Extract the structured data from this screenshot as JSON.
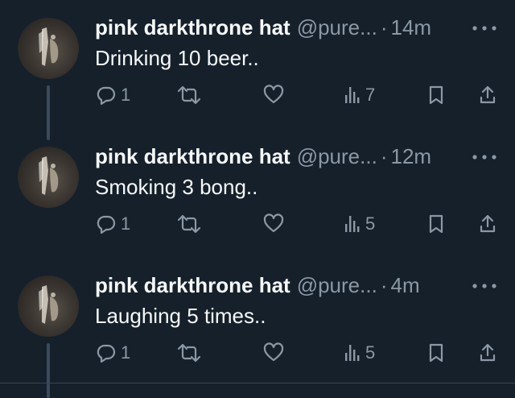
{
  "colors": {
    "background": "#15202b",
    "text_primary": "#f7f9f9",
    "text_secondary": "#8b98a5",
    "thread_line": "#3a4a5a"
  },
  "tweets": [
    {
      "name": "pink darkthrone hat",
      "handle": "@pure...",
      "separator": "·",
      "time": "14m",
      "text": "Drinking 10 beer..",
      "replies": "1",
      "views": "7",
      "icons": [
        "more-icon",
        "reply-icon",
        "retweet-icon",
        "like-icon",
        "views-icon",
        "bookmark-icon",
        "share-icon"
      ]
    },
    {
      "name": "pink darkthrone hat",
      "handle": "@pure...",
      "separator": "·",
      "time": "12m",
      "text": "Smoking 3 bong..",
      "replies": "1",
      "views": "5",
      "icons": [
        "more-icon",
        "reply-icon",
        "retweet-icon",
        "like-icon",
        "views-icon",
        "bookmark-icon",
        "share-icon"
      ]
    },
    {
      "name": "pink darkthrone hat",
      "handle": "@pure...",
      "separator": "·",
      "time": "4m",
      "text": "Laughing 5 times..",
      "replies": "1",
      "views": "5",
      "icons": [
        "more-icon",
        "reply-icon",
        "retweet-icon",
        "like-icon",
        "views-icon",
        "bookmark-icon",
        "share-icon"
      ]
    }
  ]
}
